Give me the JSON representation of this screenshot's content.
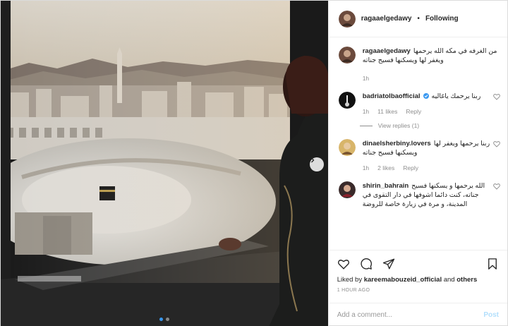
{
  "post": {
    "username": "ragaaelgedawy",
    "follow_separator": "•",
    "follow_label": "Following"
  },
  "comments": [
    {
      "username": "ragaaelgedawy",
      "text": "من الغرفه في مكه الله يرحمها ويغفر لها ويسكنها فسيح جناته",
      "time": "1h",
      "likes": "",
      "reply": ""
    },
    {
      "username": "badriatolbaofficial",
      "verified": true,
      "text": "ربنا يرحمك ياغاليه",
      "time": "1h",
      "likes": "11 likes",
      "reply": "Reply"
    },
    {
      "username": "dinaelsherbiny.lovers",
      "text": "ربنا يرحمها ويغفر لها ويسكنها فسيح جناته",
      "time": "1h",
      "likes": "2 likes",
      "reply": "Reply"
    },
    {
      "username": "shirin_bahrain",
      "text": "الله يرحمها و يسكنها فسيح جناته، كنت دائما اشوفها في دار التقوى في المدينة، و مرة في زيارة خاصة للروضة",
      "time": "",
      "likes": "",
      "reply": ""
    }
  ],
  "view_replies": "View replies (1)",
  "actions": {
    "like_icon": "heart-icon",
    "comment_icon": "comment-icon",
    "share_icon": "paper-plane-icon",
    "save_icon": "bookmark-icon"
  },
  "liked_by": {
    "prefix": "Liked by",
    "user": "kareemabouzeid_official",
    "joiner": "and",
    "others": "others"
  },
  "timestamp": "1 HOUR AGO",
  "add_comment": {
    "placeholder": "Add a comment...",
    "post_label": "Post"
  },
  "carousel": {
    "slide_count": 2,
    "active_index": 0
  },
  "colors": {
    "accent": "#3897f0",
    "verified": "#3897f0",
    "post_disabled": "#b2dffc",
    "secondary_text": "#8e8e8e"
  }
}
